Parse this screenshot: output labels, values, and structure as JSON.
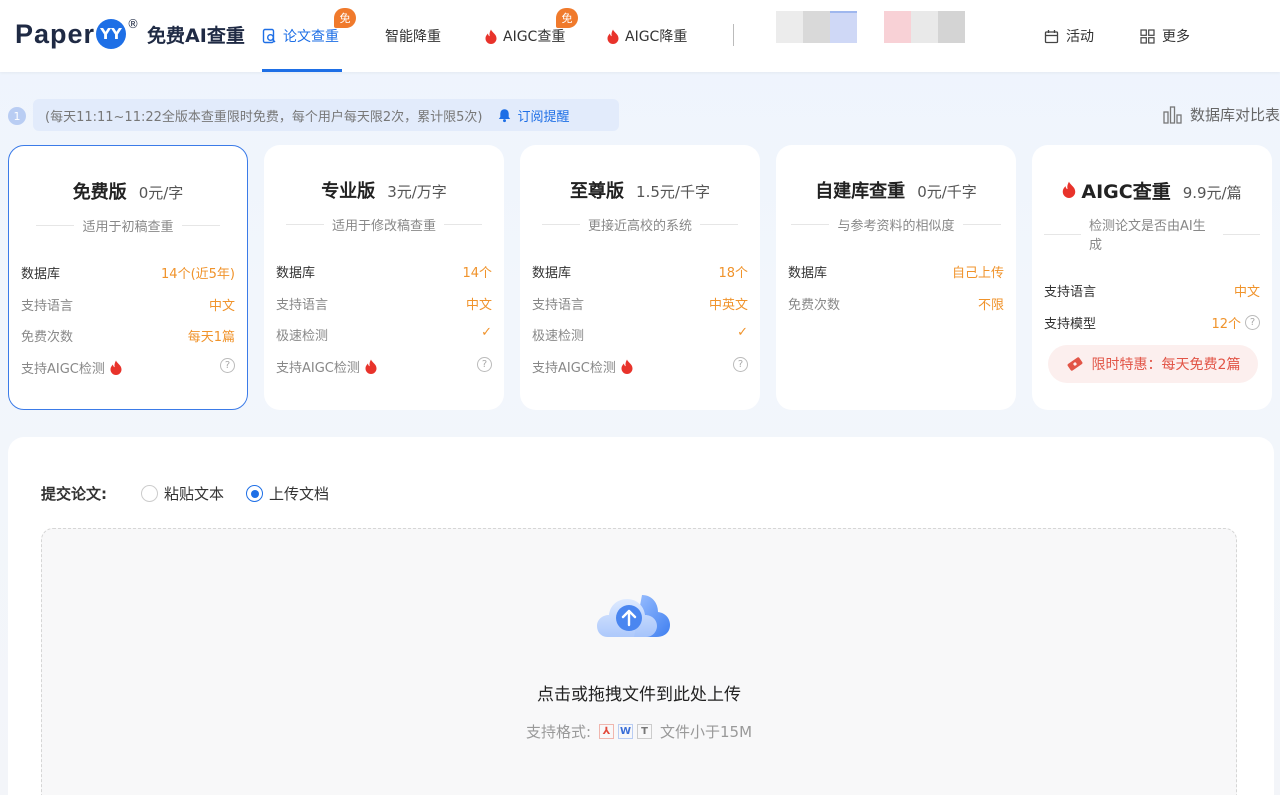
{
  "header": {
    "logo_word": "Paper",
    "logo_badge": "YY",
    "logo_reg": "®",
    "logo_sub": "免费AI查重",
    "nav": [
      {
        "label": "论文查重",
        "tag": "免"
      },
      {
        "label": "智能降重",
        "tag": ""
      },
      {
        "label": "AIGC查重",
        "tag": "免"
      },
      {
        "label": "AIGC降重",
        "tag": ""
      }
    ],
    "activity_label": "活动",
    "more_label": "更多"
  },
  "notice": {
    "index": "1",
    "text": "(每天11:11~11:22全版本查重限时免费，每个用户每天限2次，累计限5次)",
    "subscribe_label": "订阅提醒",
    "db_compare_label": "数据库对比表"
  },
  "cards": [
    {
      "title": "免费版",
      "price": "0元/字",
      "subtitle": "适用于初稿查重",
      "rows": [
        {
          "k": "数据库",
          "v": "14个(近5年)"
        },
        {
          "k": "支持语言",
          "v": "中文"
        },
        {
          "k": "免费次数",
          "v": "每天1篇"
        },
        {
          "k": "支持AIGC检测",
          "v": "?"
        }
      ]
    },
    {
      "title": "专业版",
      "price": "3元/万字",
      "subtitle": "适用于修改稿查重",
      "rows": [
        {
          "k": "数据库",
          "v": "14个"
        },
        {
          "k": "支持语言",
          "v": "中文"
        },
        {
          "k": "极速检测",
          "v": "✓"
        },
        {
          "k": "支持AIGC检测",
          "v": "?"
        }
      ]
    },
    {
      "title": "至尊版",
      "price": "1.5元/千字",
      "subtitle": "更接近高校的系统",
      "rows": [
        {
          "k": "数据库",
          "v": "18个"
        },
        {
          "k": "支持语言",
          "v": "中英文"
        },
        {
          "k": "极速检测",
          "v": "✓"
        },
        {
          "k": "支持AIGC检测",
          "v": "?"
        }
      ]
    },
    {
      "title": "自建库查重",
      "price": "0元/千字",
      "subtitle": "与参考资料的相似度",
      "rows": [
        {
          "k": "数据库",
          "v": "自己上传"
        },
        {
          "k": "免费次数",
          "v": "不限"
        }
      ]
    },
    {
      "title": "AIGC查重",
      "price": "9.9元/篇",
      "subtitle": "检测论文是否由AI生成",
      "rows": [
        {
          "k": "支持语言",
          "v": "中文"
        },
        {
          "k": "支持模型",
          "v": "12个"
        }
      ],
      "promo": "限时特惠：每天免费2篇"
    }
  ],
  "submit": {
    "label": "提交论文:",
    "option_paste": "粘贴文本",
    "option_upload": "上传文档",
    "drop_text": "点击或拖拽文件到此处上传",
    "formats_label": "支持格式:",
    "formats_note": "文件小于15M"
  },
  "colors": {
    "accent": "#1e6fe6",
    "orange": "#f0932b",
    "red": "#e25547"
  }
}
